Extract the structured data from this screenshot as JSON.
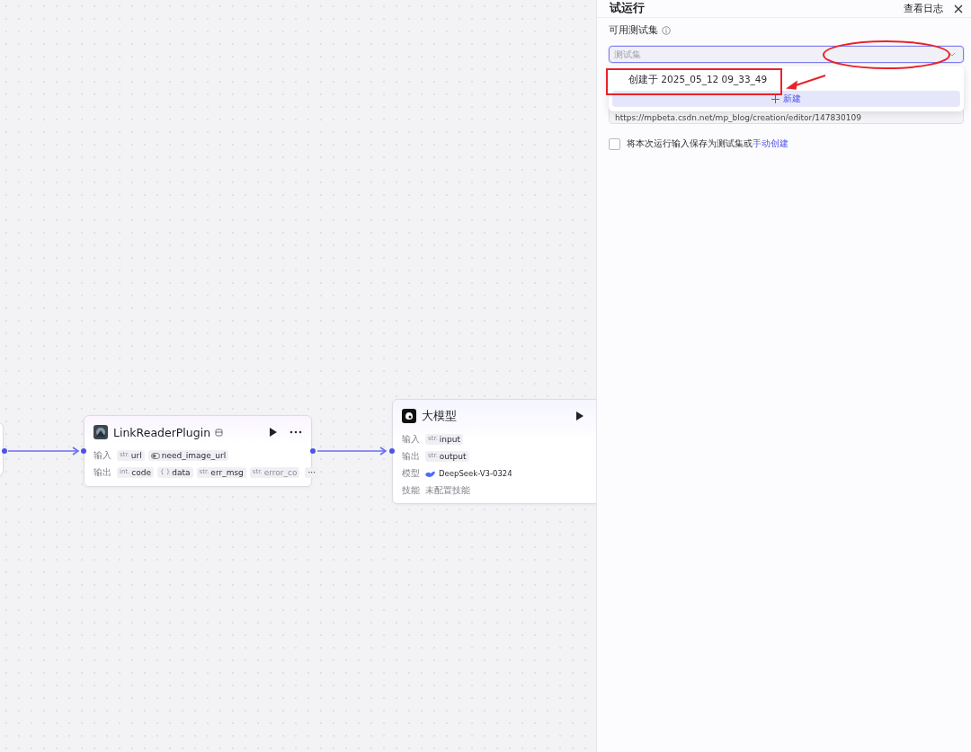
{
  "nodes": [
    {
      "kind": "plugin",
      "title": "LinkReaderPlugin",
      "rows": [
        {
          "label": "输入",
          "pills": [
            {
              "type": "str.",
              "name": "url",
              "faded": false
            },
            {
              "kind": "toggle",
              "name": "need_image_url",
              "faded": false
            }
          ]
        },
        {
          "label": "输出",
          "pills": [
            {
              "type": "int.",
              "name": "code",
              "faded": false
            },
            {
              "type": "{ }",
              "name": "data",
              "faded": false
            },
            {
              "type": "str.",
              "name": "err_msg",
              "faded": false
            },
            {
              "type": "str.",
              "name": "error_co",
              "faded": true
            }
          ],
          "more": "···"
        }
      ]
    },
    {
      "kind": "llm",
      "title": "大模型",
      "rows": [
        {
          "label": "输入",
          "pills": [
            {
              "type": "str.",
              "name": "input",
              "faded": false
            }
          ]
        },
        {
          "label": "输出",
          "pills": [
            {
              "type": "str.",
              "name": "output",
              "faded": false
            }
          ]
        }
      ],
      "model_label": "模型",
      "model": "DeepSeek-V3-0324",
      "skills_label": "技能",
      "skills": "未配置技能"
    }
  ],
  "panel": {
    "title": "试运行",
    "log_link": "查看日志",
    "testset_label": "可用测试集",
    "testset_select": {
      "placeholder": "测试集",
      "focused": true
    },
    "dropdown": {
      "options": [
        {
          "label": "创建于 2025_05_12 09_33_49",
          "selected": false
        }
      ],
      "new_button": "新建"
    },
    "url_field": {
      "value": "https://mpbeta.csdn.net/mp_blog/creation/editor/147830109"
    },
    "save_option": {
      "checked": false,
      "text": "将本次运行输入保存为测试集或",
      "link": "手动创建"
    }
  },
  "annotations": [
    {
      "kind": "ellipse"
    },
    {
      "kind": "frame"
    },
    {
      "kind": "arrow"
    }
  ]
}
